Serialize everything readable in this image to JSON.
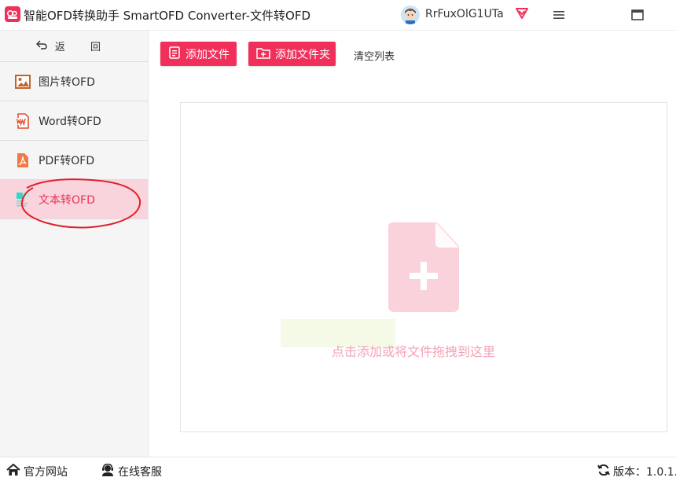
{
  "titlebar": {
    "title": "智能OFD转换助手 SmartOFD Converter-文件转OFD",
    "username": "RrFuxOlG1UTa"
  },
  "sidebar": {
    "back_label": "返 回",
    "items": [
      {
        "label": "图片转OFD",
        "icon": "image-icon"
      },
      {
        "label": "Word转OFD",
        "icon": "word-icon"
      },
      {
        "label": "PDF转OFD",
        "icon": "pdf-icon"
      },
      {
        "label": "文本转OFD",
        "icon": "text-file-icon",
        "active": true
      }
    ]
  },
  "toolbar": {
    "add_file_label": "添加文件",
    "add_folder_label": "添加文件夹",
    "clear_label": "清空列表"
  },
  "dropzone": {
    "hint": "点击添加或将文件拖拽到这里"
  },
  "footer": {
    "official_site_label": "官方网站",
    "online_service_label": "在线客服",
    "version_label": "版本：1.0.1.0"
  },
  "colors": {
    "accent": "#f0305a",
    "active_bg": "#f9d4dd",
    "annotation": "#e0202a"
  }
}
